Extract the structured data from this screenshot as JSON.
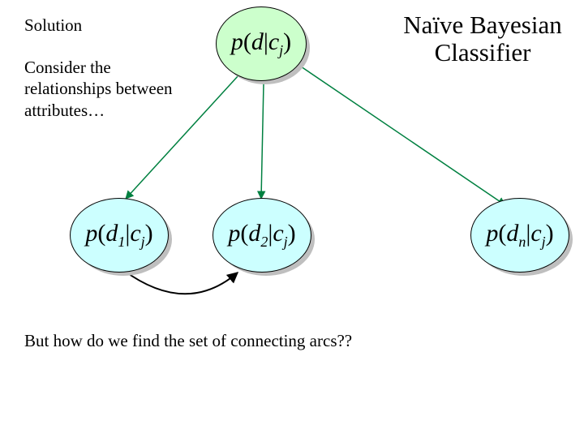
{
  "header": {
    "solution": "Solution",
    "consider": "Consider the relationships between attributes…",
    "title_line1": "Naïve Bayesian",
    "title_line2": "Classifier"
  },
  "nodes": {
    "root_p": "p",
    "root_d": "d",
    "root_c": "c",
    "root_j": "j",
    "c1_p": "p",
    "c1_d": "d",
    "c1_1": "1",
    "c1_c": "c",
    "c1_j": "j",
    "c2_p": "p",
    "c2_d": "d",
    "c2_2": "2",
    "c2_c": "c",
    "c2_j": "j",
    "cn_p": "p",
    "cn_d": "d",
    "cn_n": "n",
    "cn_c": "c",
    "cn_j": "j"
  },
  "footer": "But how do we find the set of connecting arcs??",
  "colors": {
    "arrow": "#008040",
    "curve": "#000000"
  }
}
